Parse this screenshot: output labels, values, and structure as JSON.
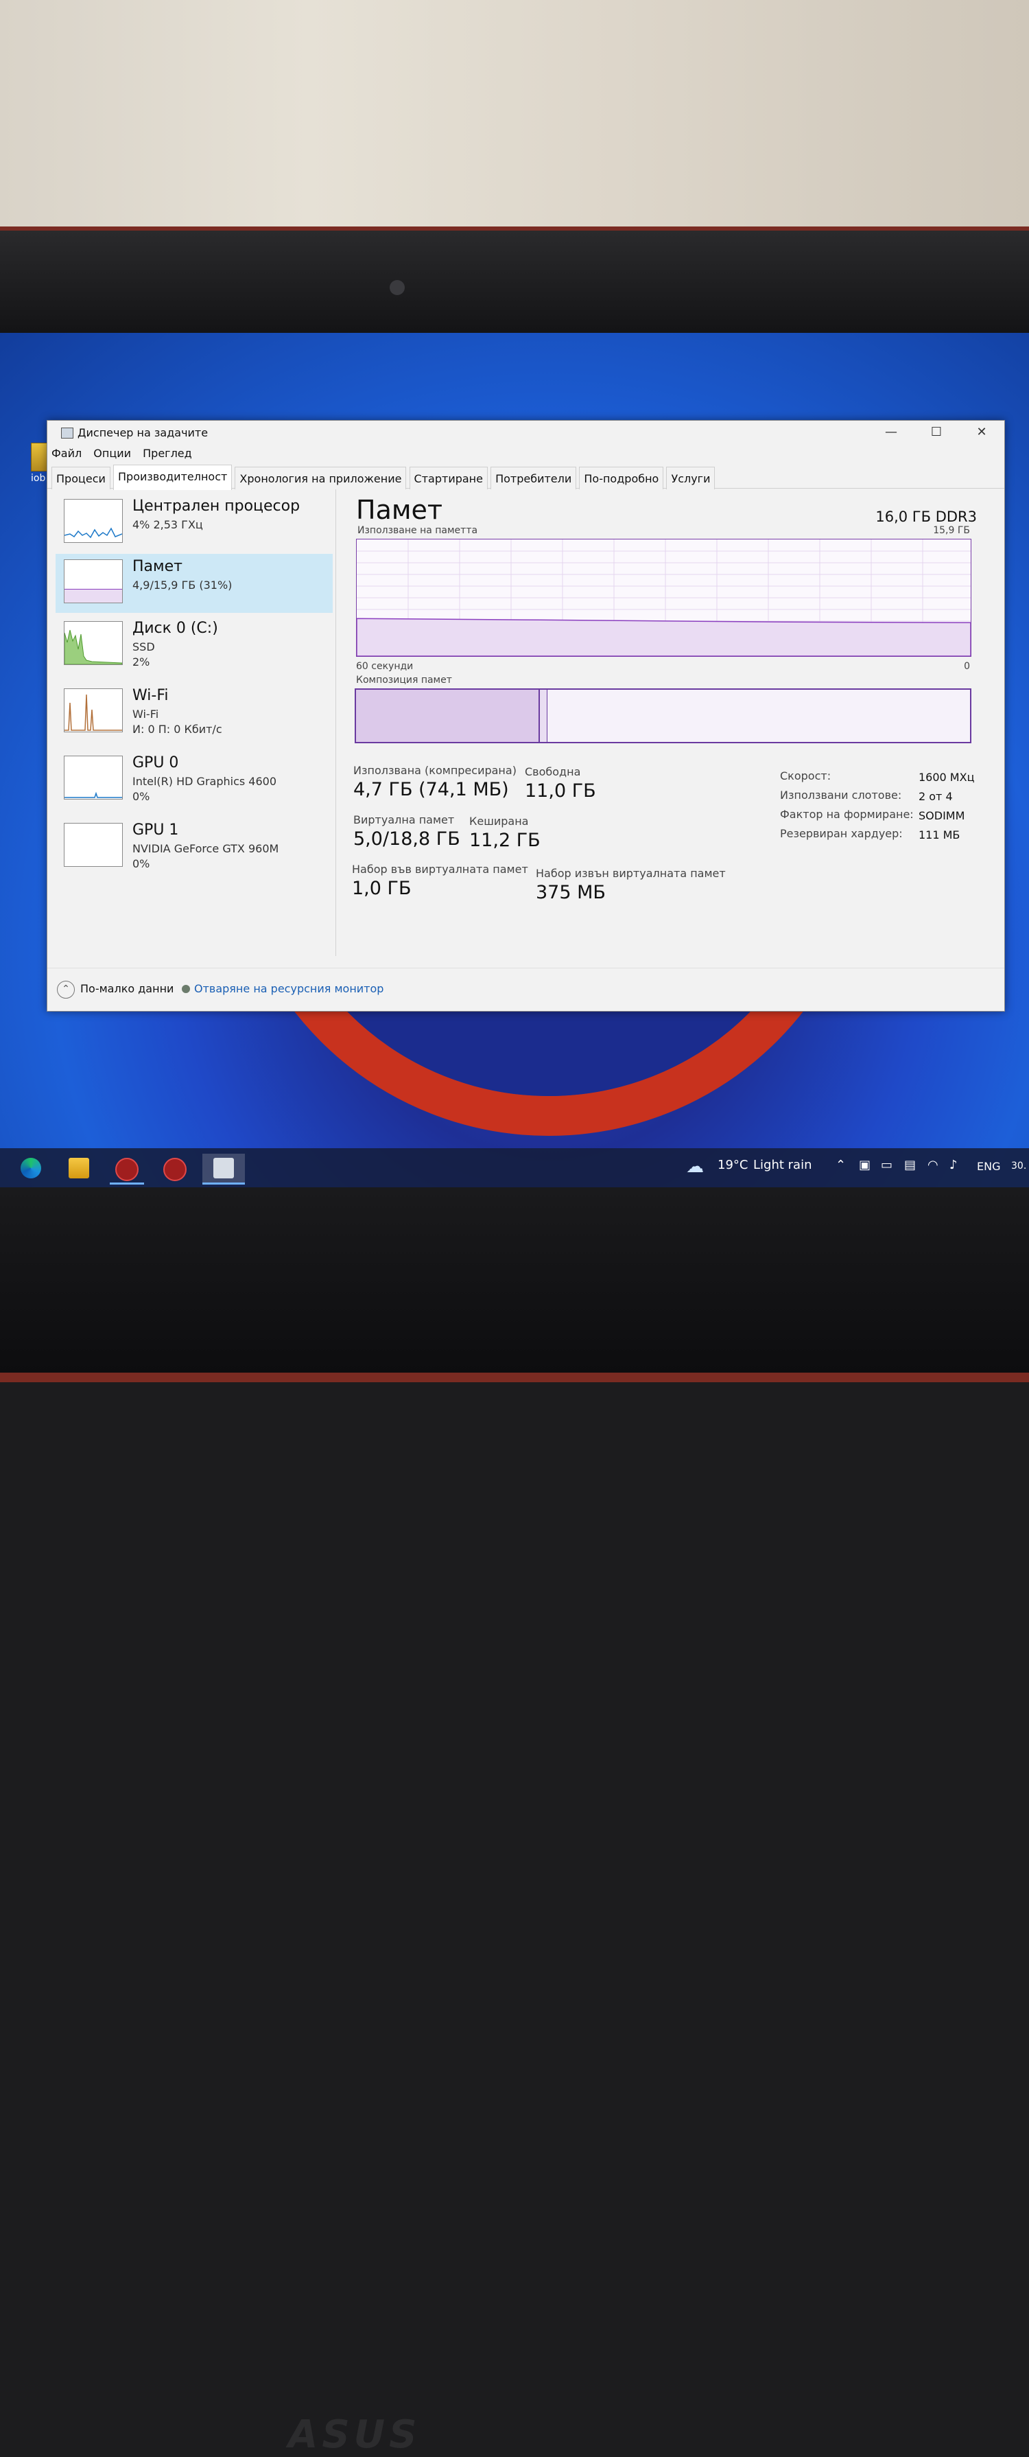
{
  "desktop": {
    "icon_label": "iob"
  },
  "window": {
    "title": "Диспечер на задачите",
    "controls": {
      "minimize": "—",
      "maximize": "☐",
      "close": "✕"
    },
    "menu": [
      "Файл",
      "Опции",
      "Преглед"
    ],
    "tabs": [
      "Процеси",
      "Производителност",
      "Хронология на приложение",
      "Стартиране",
      "Потребители",
      "По-подробно",
      "Услуги"
    ],
    "active_tab": "Производителност"
  },
  "sidebar": {
    "items": [
      {
        "name": "Централен процесор",
        "line2": "4%  2,53 ГХц",
        "line3": ""
      },
      {
        "name": "Памет",
        "line2": "4,9/15,9 ГБ (31%)",
        "line3": ""
      },
      {
        "name": "Диск 0 (C:)",
        "line2": "SSD",
        "line3": "2%"
      },
      {
        "name": "Wi-Fi",
        "line2": "Wi-Fi",
        "line3": "И: 0  П: 0 Кбит/с"
      },
      {
        "name": "GPU 0",
        "line2": "Intel(R) HD Graphics 4600",
        "line3": "0%"
      },
      {
        "name": "GPU 1",
        "line2": "NVIDIA GeForce GTX 960M",
        "line3": "0%"
      }
    ],
    "selected": "Памет"
  },
  "memory": {
    "title": "Памет",
    "spec": "16,0 ГБ DDR3",
    "usage_label": "Използване на паметта",
    "usage_max": "15,9 ГБ",
    "time_label": "60 секунди",
    "zero_label": "0",
    "composition_label": "Композиция памет",
    "usage_fraction": 0.31,
    "in_use": {
      "label": "Използвана (компресирана)",
      "value": "4,7 ГБ (74,1 МБ)"
    },
    "available": {
      "label": "Свободна",
      "value": "11,0 ГБ"
    },
    "committed": {
      "label": "Виртуална памет",
      "value": "5,0/18,8 ГБ"
    },
    "cached": {
      "label": "Кеширана",
      "value": "11,2 ГБ"
    },
    "paged_pool": {
      "label": "Набор във виртуалната памет",
      "value": "1,0 ГБ"
    },
    "nonpaged_pool": {
      "label": "Набор извън виртуалната памет",
      "value": "375 МБ"
    },
    "details": [
      {
        "k": "Скорост:",
        "v": "1600 МХц"
      },
      {
        "k": "Използвани слотове:",
        "v": "2 от 4"
      },
      {
        "k": "Фактор на формиране:",
        "v": "SODIMM"
      },
      {
        "k": "Резервиран хардуер:",
        "v": "111 МБ"
      }
    ]
  },
  "footer": {
    "less": "По-малко данни",
    "resource_monitor": "Отваряне на ресурсния монитор"
  },
  "taskbar": {
    "weather_temp": "19°C",
    "weather_text": "Light rain",
    "lang": "ENG",
    "clock_partial": "30."
  },
  "colors": {
    "memory_accent": "#8b3fbf",
    "selected_bg": "#cde8f6",
    "link": "#1a5fb4"
  }
}
